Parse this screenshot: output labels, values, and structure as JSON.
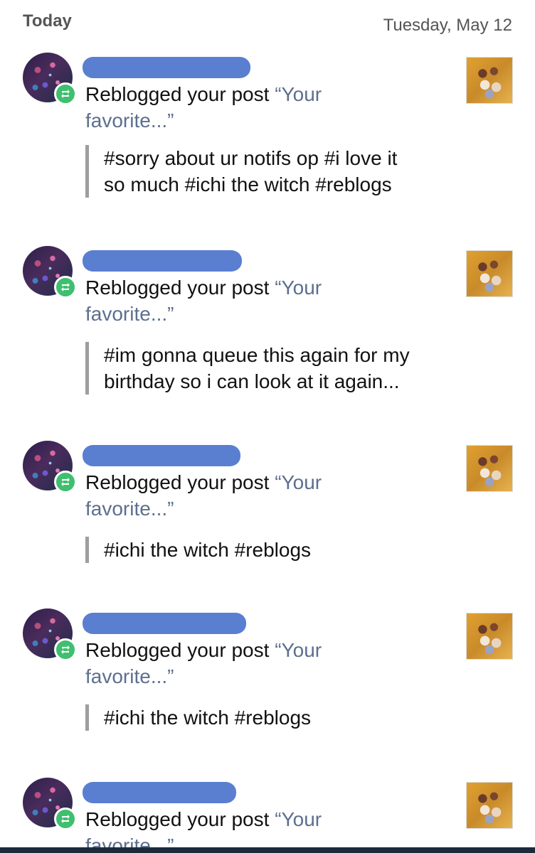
{
  "header": {
    "today_label": "Today",
    "date_label": "Tuesday, May 12"
  },
  "notifications": [
    {
      "action_text": "Reblogged your post ",
      "post_title": "“Your favorite...”",
      "tags_line1": "#sorry about ur notifs op #i love it",
      "tags_line2": "so much #ichi the witch #reblogs"
    },
    {
      "action_text": "Reblogged your post ",
      "post_title": "“Your favorite...”",
      "tags_line1": "#im gonna queue this again for my",
      "tags_line2": "birthday so i can look at it again..."
    },
    {
      "action_text": "Reblogged your post ",
      "post_title": "“Your favorite...”",
      "tags_line1": "#ichi the witch #reblogs",
      "tags_line2": ""
    },
    {
      "action_text": "Reblogged your post ",
      "post_title": "“Your favorite...”",
      "tags_line1": "#ichi the witch #reblogs",
      "tags_line2": ""
    },
    {
      "action_text": "Reblogged your post ",
      "post_title": "“Your favorite...”"
    }
  ],
  "colors": {
    "redaction": "#5a7fd1",
    "reblog_badge": "#3fbf6f",
    "post_title": "#5c6f8f"
  },
  "icons": {
    "reblog_badge": "reblog-icon"
  }
}
